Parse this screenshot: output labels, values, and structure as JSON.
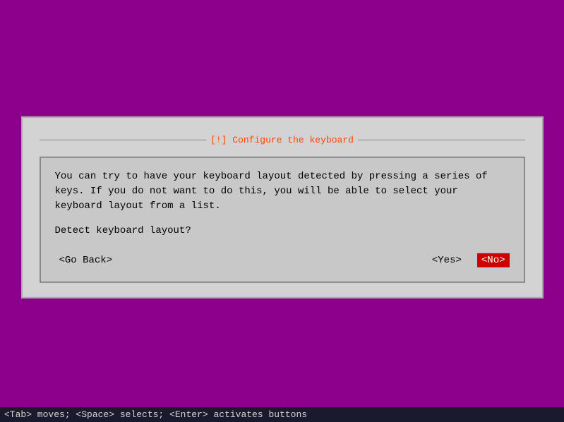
{
  "background": {
    "color": "#8b008b"
  },
  "dialog": {
    "title": "[!] Configure the keyboard",
    "title_display": "Configure the keyboard",
    "title_prefix": "[!]",
    "body_text": "You can try to have your keyboard layout detected by pressing a series of keys. If you do not want to do this, you will be able to select your keyboard layout from a list.",
    "detect_prompt": "Detect keyboard layout?",
    "buttons": {
      "go_back": "<Go Back>",
      "yes": "<Yes>",
      "no": "<No>"
    }
  },
  "status_bar": {
    "text": "<Tab> moves; <Space> selects; <Enter> activates buttons"
  }
}
